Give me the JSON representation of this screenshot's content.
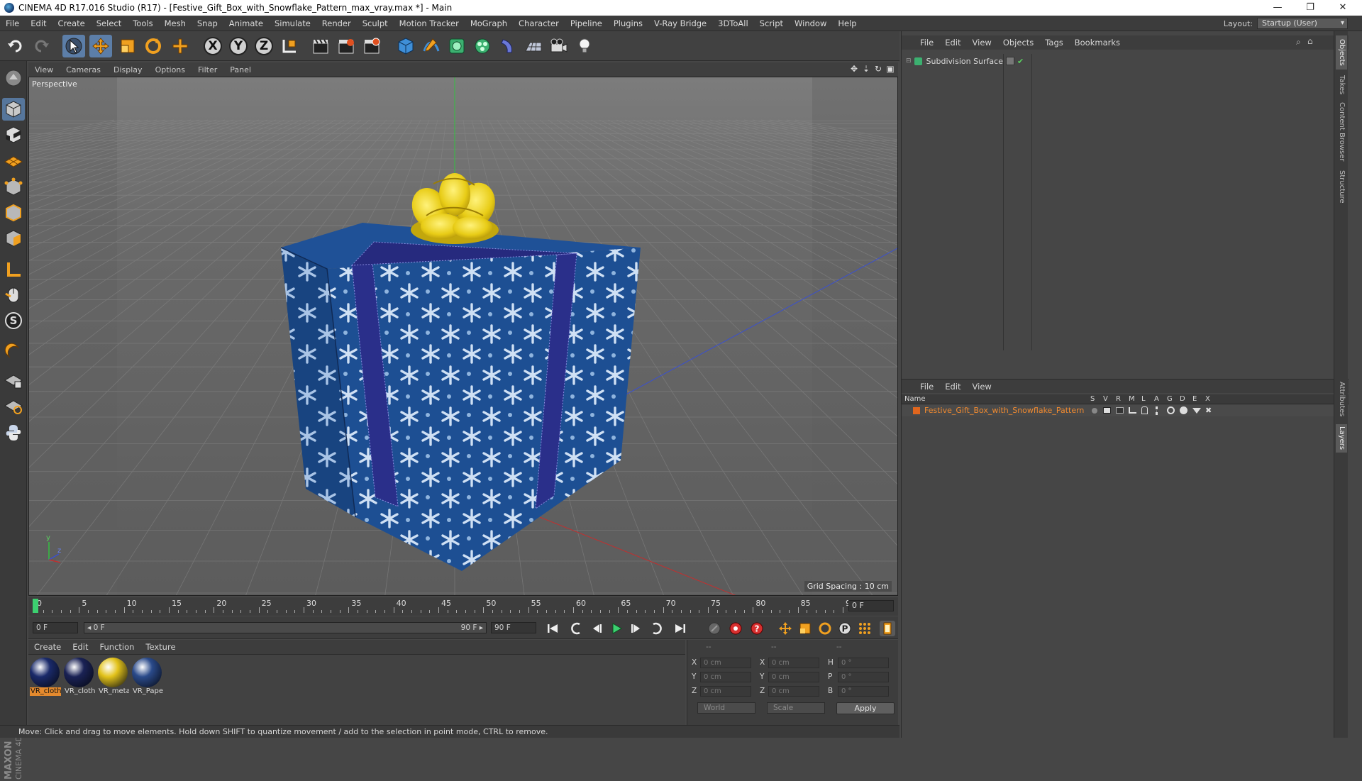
{
  "window": {
    "title": "CINEMA 4D R17.016 Studio (R17) - [Festive_Gift_Box_with_Snowflake_Pattern_max_vray.max *] - Main",
    "minimize": "—",
    "restore": "❐",
    "close": "✕"
  },
  "menubar": {
    "items": [
      "File",
      "Edit",
      "Create",
      "Select",
      "Tools",
      "Mesh",
      "Snap",
      "Animate",
      "Simulate",
      "Render",
      "Sculpt",
      "Motion Tracker",
      "MoGraph",
      "Character",
      "Pipeline",
      "Plugins",
      "V-Ray Bridge",
      "3DToAll",
      "Script",
      "Window",
      "Help"
    ],
    "layout_label": "Layout:",
    "layout_value": "Startup (User)"
  },
  "toolbar": {
    "axis_x": "X",
    "axis_y": "Y",
    "axis_z": "Z"
  },
  "viewport": {
    "menu": [
      "View",
      "Cameras",
      "Display",
      "Options",
      "Filter",
      "Panel"
    ],
    "label": "Perspective",
    "grid_spacing": "Grid Spacing : 10 cm",
    "axis_y": "y",
    "axis_z": "z"
  },
  "timeline": {
    "ticks": [
      "0",
      "5",
      "10",
      "15",
      "20",
      "25",
      "30",
      "35",
      "40",
      "45",
      "50",
      "55",
      "60",
      "65",
      "70",
      "75",
      "80",
      "85",
      "90"
    ],
    "current_frame": "0 F"
  },
  "transport": {
    "start_field": "0 F",
    "range_start": "◂ 0 F",
    "range_end": "90 F ▸",
    "end_field": "90 F"
  },
  "materials": {
    "menu": [
      "Create",
      "Edit",
      "Function",
      "Texture"
    ],
    "items": [
      {
        "label": "VR_cloth",
        "selected": true,
        "color": "#1a2a6a"
      },
      {
        "label": "VR_cloth",
        "selected": false,
        "color": "#1a2255"
      },
      {
        "label": "VR_metal",
        "selected": false,
        "color": "#e2c21a"
      },
      {
        "label": "VR_Paper",
        "selected": false,
        "color": "#2a4a8a"
      }
    ]
  },
  "coords": {
    "header": [
      "--",
      "--",
      "--"
    ],
    "rows": [
      {
        "a": "X",
        "v1": "0 cm",
        "b": "X",
        "v2": "0 cm",
        "c": "H",
        "v3": "0 °"
      },
      {
        "a": "Y",
        "v1": "0 cm",
        "b": "Y",
        "v2": "0 cm",
        "c": "P",
        "v3": "0 °"
      },
      {
        "a": "Z",
        "v1": "0 cm",
        "b": "Z",
        "v2": "0 cm",
        "c": "B",
        "v3": "0 °"
      }
    ],
    "space": "World",
    "mode": "Scale",
    "apply": "Apply"
  },
  "status": {
    "text": "Move: Click and drag to move elements. Hold down SHIFT to quantize movement / add to the selection in point mode, CTRL to remove."
  },
  "objects_panel": {
    "menu": [
      "File",
      "Edit",
      "View",
      "Objects",
      "Tags",
      "Bookmarks"
    ],
    "object_name": "Subdivision Surface"
  },
  "layers_panel": {
    "menu": [
      "File",
      "Edit",
      "View"
    ],
    "columns": [
      "Name",
      "S",
      "V",
      "R",
      "M",
      "L",
      "A",
      "G",
      "D",
      "E",
      "X"
    ],
    "layer_name": "Festive_Gift_Box_with_Snowflake_Pattern",
    "layer_color": "#e0661e"
  },
  "side_tabs": [
    "Objects",
    "Takes",
    "Content Browser",
    "Structure",
    "Attributes",
    "Layers"
  ],
  "maxon": {
    "line1": "MAXON",
    "line2": "CINEMA 4D"
  }
}
